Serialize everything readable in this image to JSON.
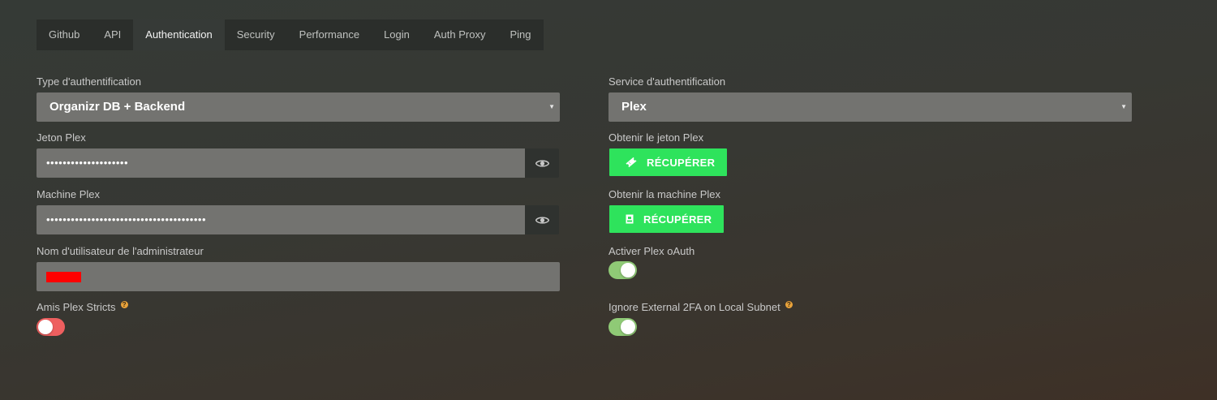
{
  "tabs": [
    {
      "label": "Github"
    },
    {
      "label": "API"
    },
    {
      "label": "Authentication",
      "active": true
    },
    {
      "label": "Security"
    },
    {
      "label": "Performance"
    },
    {
      "label": "Login"
    },
    {
      "label": "Auth Proxy"
    },
    {
      "label": "Ping"
    }
  ],
  "left": {
    "auth_type": {
      "label": "Type d'authentification",
      "value": "Organizr DB + Backend"
    },
    "plex_token": {
      "label": "Jeton Plex",
      "value": "••••••••••••••••••••"
    },
    "plex_machine": {
      "label": "Machine Plex",
      "value": "•••••••••••••••••••••••••••••••••••••••"
    },
    "admin_username": {
      "label": "Nom d'utilisateur de l'administrateur",
      "value": ""
    },
    "strict_friends": {
      "label": "Amis Plex Stricts",
      "help": "?",
      "enabled": false
    }
  },
  "right": {
    "auth_service": {
      "label": "Service d'authentification",
      "value": "Plex"
    },
    "get_token": {
      "label": "Obtenir le jeton Plex",
      "button": "RÉCUPÉRER"
    },
    "get_machine": {
      "label": "Obtenir la machine Plex",
      "button": "RÉCUPÉRER"
    },
    "plex_oauth": {
      "label": "Activer Plex oAuth",
      "enabled": true
    },
    "ignore_2fa": {
      "label": "Ignore External 2FA on Local Subnet",
      "help": "?",
      "enabled": true
    }
  },
  "icons": {
    "caret": "▼",
    "eye": "eye-icon",
    "ticket": "ticket-icon",
    "server": "server-icon"
  },
  "colors": {
    "green_button": "#2ee35c",
    "toggle_on": "#8fca76",
    "toggle_off": "#ee5f5f",
    "help": "#e8a23a",
    "redaction": "#ff0000"
  }
}
